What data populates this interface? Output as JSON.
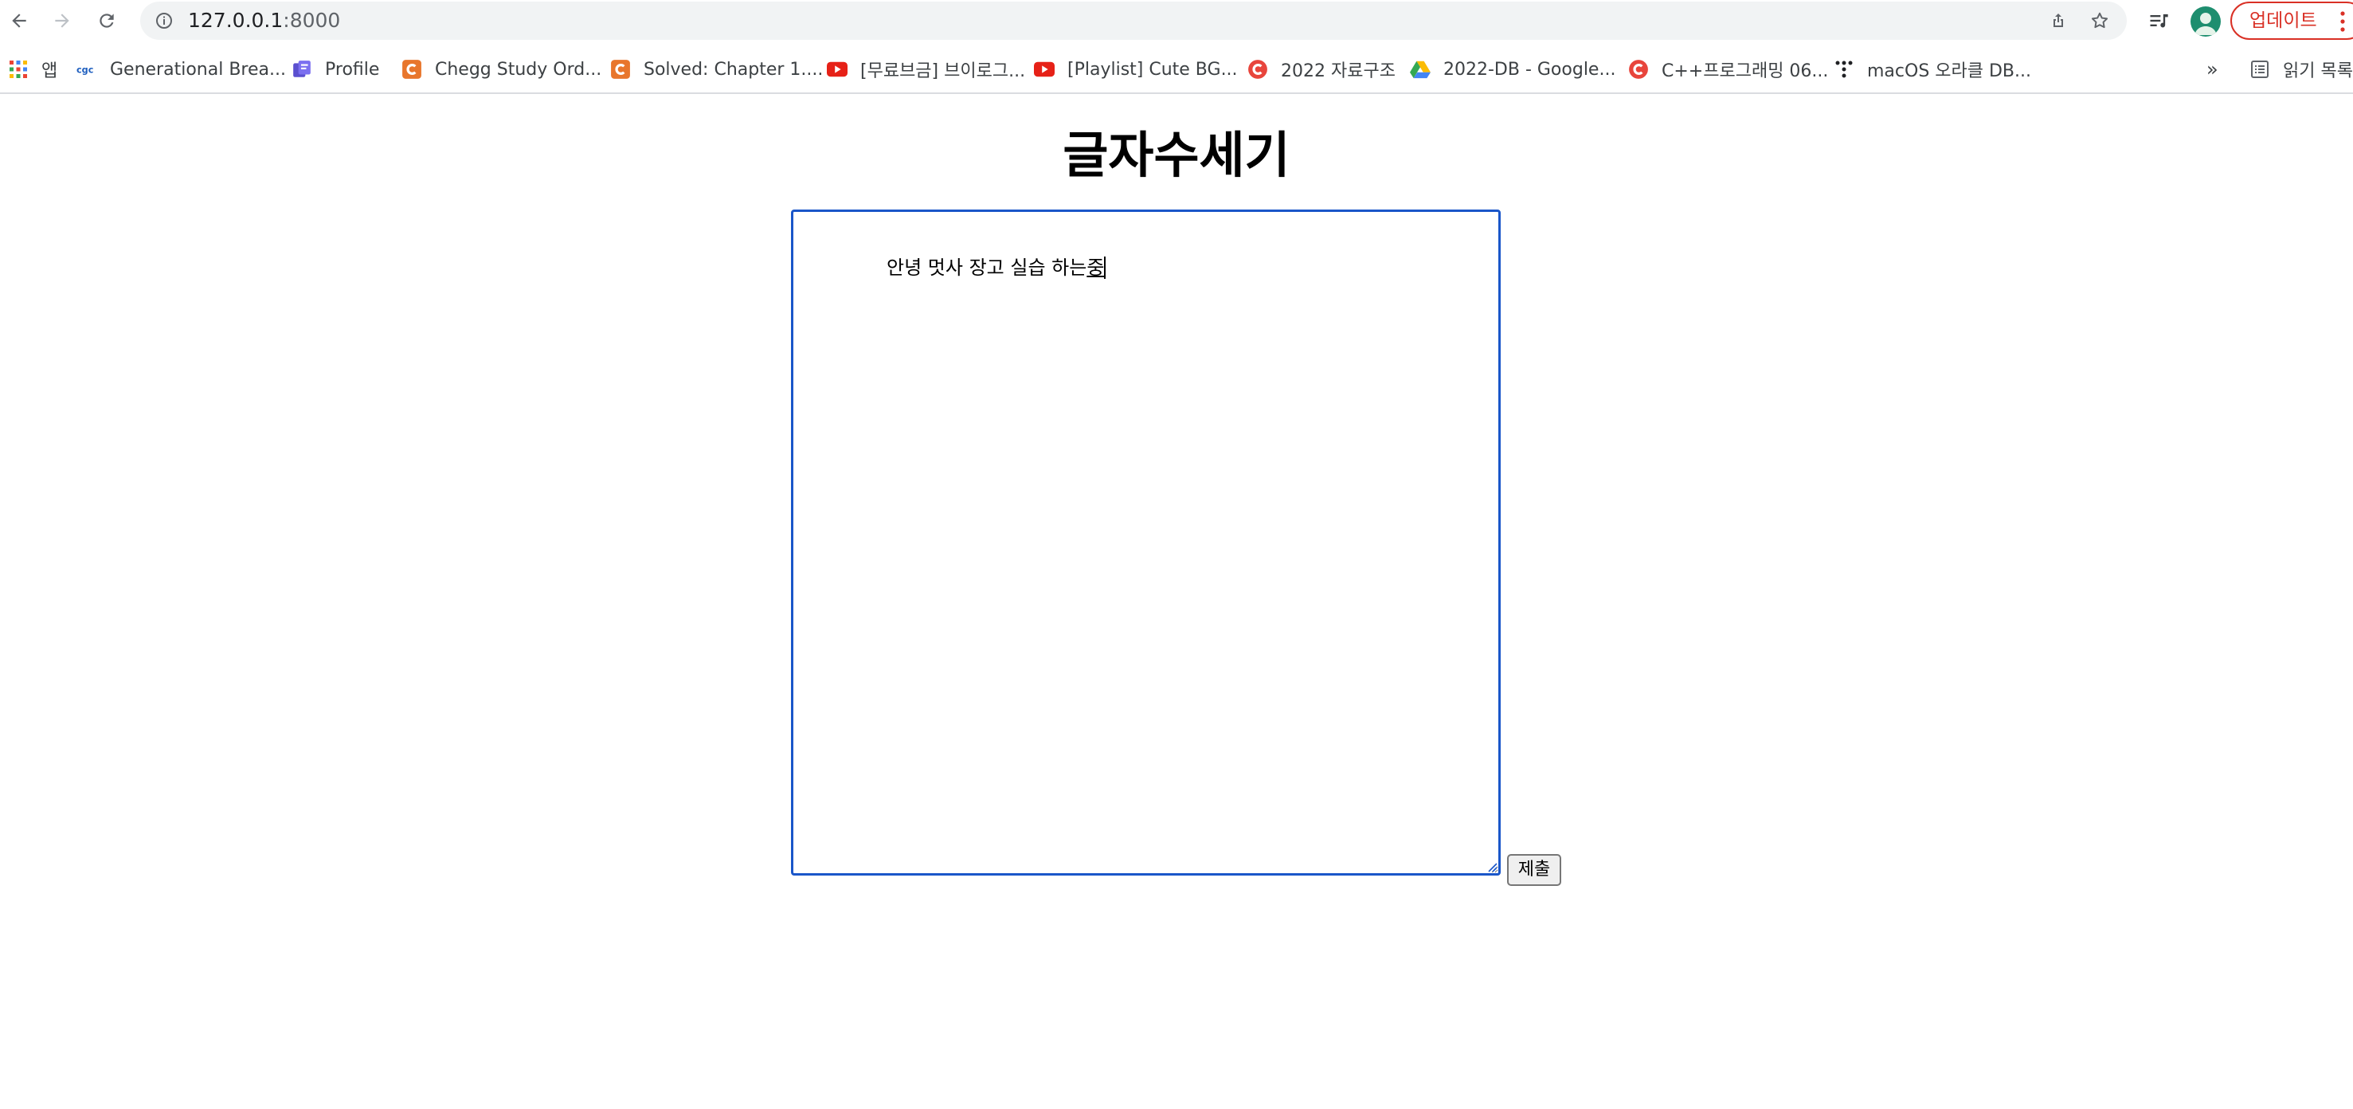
{
  "browser": {
    "url_host": "127.0.0.1",
    "url_port": ":8000",
    "update_label": "업데이트"
  },
  "bookmarks": [
    {
      "label": "앱",
      "icon": "apps-grid-icon"
    },
    {
      "label": "Generational Brea...",
      "icon": "cgc-logo-icon"
    },
    {
      "label": "Profile",
      "icon": "profile-app-icon"
    },
    {
      "label": "Chegg Study Ord...",
      "icon": "chegg-icon"
    },
    {
      "label": "Solved: Chapter 1....",
      "icon": "chegg-icon"
    },
    {
      "label": "[무료브금] 브이로그...",
      "icon": "youtube-icon"
    },
    {
      "label": "[Playlist] Cute BG...",
      "icon": "youtube-icon"
    },
    {
      "label": "2022 자료구조",
      "icon": "c-logo-icon"
    },
    {
      "label": "2022-DB - Google...",
      "icon": "google-drive-icon"
    },
    {
      "label": "C++프로그래밍 06...",
      "icon": "c-logo-icon"
    },
    {
      "label": "macOS 오라클 DB...",
      "icon": "dots-logo-icon"
    }
  ],
  "bookmarks_overflow": "»",
  "reading_list_label": "읽기 목록",
  "page": {
    "title": "글자수세기",
    "textarea_value": "안녕 멋사 장고 실습 하는",
    "textarea_composing": "중",
    "submit_label": "제출"
  },
  "colors": {
    "focus_border": "#1a56c9",
    "update_red": "#d93025",
    "youtube_red": "#e62117",
    "chegg_orange": "#e8762c"
  }
}
